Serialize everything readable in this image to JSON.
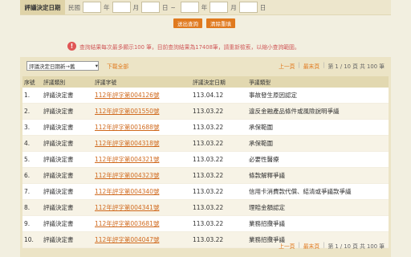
{
  "search": {
    "label": "評議決定日期",
    "era": "民國",
    "year": "年",
    "month": "月",
    "day": "日",
    "tilde": "~",
    "submit": "送出查詢",
    "reset": "清除重填"
  },
  "notice": "查詢結果每次最多顯示100 筆，目前查詢結果為17408筆，請重新檢索，以縮小查詢範圍。",
  "toolbar": {
    "sort": "評議決定日期新→舊",
    "download": "下載全部"
  },
  "pager": {
    "prev": "上一頁",
    "next": "最末頁",
    "info": "第 1 / 10 頁 共 100 筆"
  },
  "table": {
    "headers": [
      "序號",
      "評議類別",
      "評議字號",
      "評議決定日期",
      "爭議類型"
    ],
    "rows": [
      {
        "no": "1.",
        "type": "評議決定書",
        "ref": "112年評字第004126號",
        "date": "113.04.12",
        "issue": "事故發生原因認定"
      },
      {
        "no": "2.",
        "type": "評議決定書",
        "ref": "112年評字第001550號",
        "date": "113.03.22",
        "issue": "違反金融產品條件或風險說明爭議"
      },
      {
        "no": "3.",
        "type": "評議決定書",
        "ref": "112年評字第001688號",
        "date": "113.03.22",
        "issue": "承保範圍"
      },
      {
        "no": "4.",
        "type": "評議決定書",
        "ref": "112年評字第004318號",
        "date": "113.03.22",
        "issue": "承保範圍"
      },
      {
        "no": "5.",
        "type": "評議決定書",
        "ref": "112年評字第004321號",
        "date": "113.03.22",
        "issue": "必要性醫療"
      },
      {
        "no": "6.",
        "type": "評議決定書",
        "ref": "112年評字第004323號",
        "date": "113.03.22",
        "issue": "條款解釋爭議"
      },
      {
        "no": "7.",
        "type": "評議決定書",
        "ref": "112年評字第004340號",
        "date": "113.03.22",
        "issue": "信用卡消費款代償、結清或爭議款爭議"
      },
      {
        "no": "8.",
        "type": "評議決定書",
        "ref": "112年評字第004341號",
        "date": "113.03.22",
        "issue": "理賠金額認定"
      },
      {
        "no": "9.",
        "type": "評議決定書",
        "ref": "112年評字第003681號",
        "date": "113.03.22",
        "issue": "業務招攬爭議"
      },
      {
        "no": "10.",
        "type": "評議決定書",
        "ref": "112年評字第004047號",
        "date": "113.03.22",
        "issue": "業務招攬爭議"
      }
    ]
  }
}
